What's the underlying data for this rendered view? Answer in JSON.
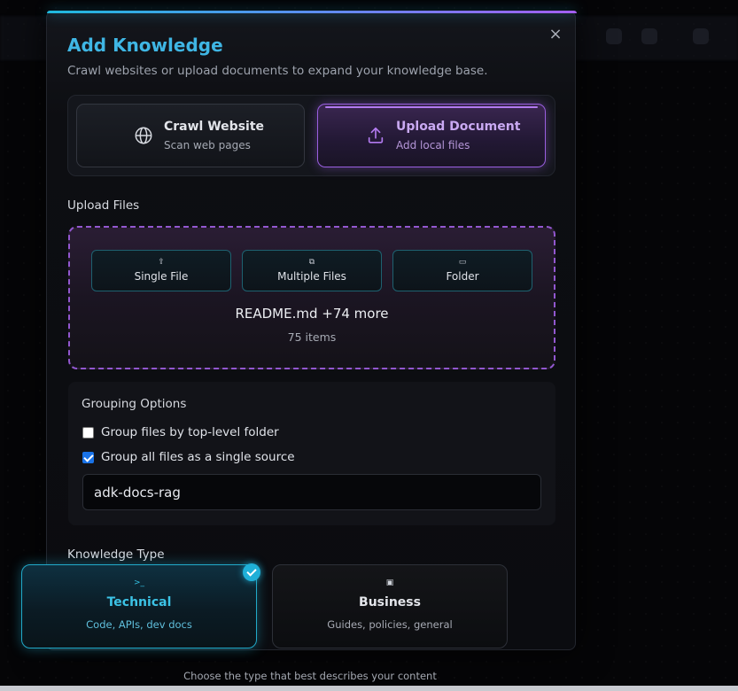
{
  "modal": {
    "title": "Add Knowledge",
    "subtitle": "Crawl websites or upload documents to expand your knowledge base.",
    "close_icon": "×"
  },
  "modes": [
    {
      "title": "Crawl Website",
      "subtitle": "Scan web pages",
      "icon": "globe-icon",
      "selected": false
    },
    {
      "title": "Upload Document",
      "subtitle": "Add local files",
      "icon": "upload-icon",
      "selected": true
    }
  ],
  "upload": {
    "section_label": "Upload Files",
    "buttons": [
      {
        "label": "Single File",
        "icon": "⇪"
      },
      {
        "label": "Multiple Files",
        "icon": "⧉"
      },
      {
        "label": "Folder",
        "icon": "▭"
      }
    ],
    "selected_name": "README.md +74 more",
    "selected_count": "75 items"
  },
  "grouping": {
    "title": "Grouping Options",
    "options": [
      {
        "label": "Group files by top-level folder",
        "checked": false
      },
      {
        "label": "Group all files as a single source",
        "checked": true
      }
    ],
    "source_name": "adk-docs-rag"
  },
  "knowledge_type": {
    "section_label": "Knowledge Type",
    "options": [
      {
        "name": "Technical",
        "description": "Code, APIs, dev docs",
        "icon": ">_",
        "selected": true
      },
      {
        "name": "Business",
        "description": "Guides, policies, general",
        "icon": "▣",
        "selected": false
      }
    ],
    "hint": "Choose the type that best describes your content"
  },
  "colors": {
    "accent_cyan": "#1fb0d8",
    "accent_purple": "#9a5fe0",
    "background": "#050507"
  }
}
